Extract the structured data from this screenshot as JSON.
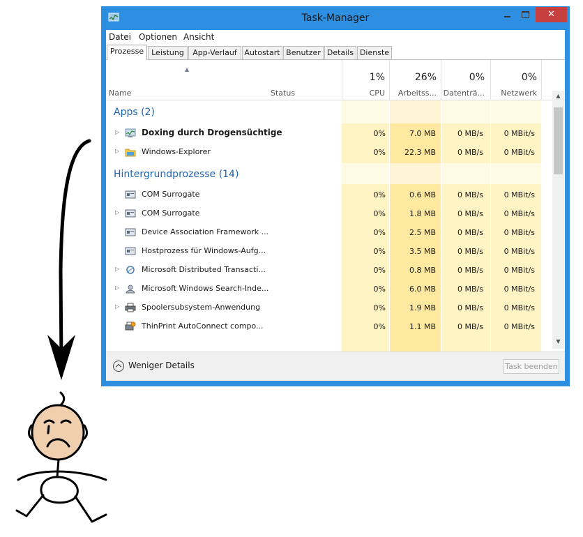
{
  "window": {
    "title": "Task-Manager"
  },
  "menu": [
    "Datei",
    "Optionen",
    "Ansicht"
  ],
  "tabs": [
    "Prozesse",
    "Leistung",
    "App-Verlauf",
    "Autostart",
    "Benutzer",
    "Details",
    "Dienste"
  ],
  "columns": {
    "name": "Name",
    "status": "Status",
    "cpu": {
      "pct": "1%",
      "label": "CPU"
    },
    "mem": {
      "pct": "26%",
      "label": "Arbeitss..."
    },
    "disk": {
      "pct": "0%",
      "label": "Datenträ..."
    },
    "net": {
      "pct": "0%",
      "label": "Netzwerk"
    }
  },
  "groups": {
    "apps": "Apps (2)",
    "background": "Hintergrundprozesse (14)"
  },
  "apps": [
    {
      "name": "Doxing durch Drogensüchtige",
      "cpu": "0%",
      "mem": "7.0 MB",
      "disk": "0 MB/s",
      "net": "0 MBit/s",
      "icon": "resource-monitor-icon"
    },
    {
      "name": "Windows-Explorer",
      "cpu": "0%",
      "mem": "22.3 MB",
      "disk": "0 MB/s",
      "net": "0 MBit/s",
      "icon": "folder-icon"
    }
  ],
  "background": [
    {
      "name": "COM Surrogate",
      "cpu": "0%",
      "mem": "0.6 MB",
      "disk": "0 MB/s",
      "net": "0 MBit/s",
      "icon": "window-app-icon"
    },
    {
      "name": "COM Surrogate",
      "cpu": "0%",
      "mem": "1.8 MB",
      "disk": "0 MB/s",
      "net": "0 MBit/s",
      "icon": "window-app-icon"
    },
    {
      "name": "Device Association Framework ...",
      "cpu": "0%",
      "mem": "2.5 MB",
      "disk": "0 MB/s",
      "net": "0 MBit/s",
      "icon": "window-app-icon"
    },
    {
      "name": "Hostprozess für Windows-Aufg...",
      "cpu": "0%",
      "mem": "3.5 MB",
      "disk": "0 MB/s",
      "net": "0 MBit/s",
      "icon": "window-app-icon"
    },
    {
      "name": "Microsoft Distributed Transacti...",
      "cpu": "0%",
      "mem": "0.8 MB",
      "disk": "0 MB/s",
      "net": "0 MBit/s",
      "icon": "transaction-icon"
    },
    {
      "name": "Microsoft Windows Search-Inde...",
      "cpu": "0%",
      "mem": "6.0 MB",
      "disk": "0 MB/s",
      "net": "0 MBit/s",
      "icon": "search-indexer-icon"
    },
    {
      "name": "Spoolersubsystem-Anwendung",
      "cpu": "0%",
      "mem": "1.9 MB",
      "disk": "0 MB/s",
      "net": "0 MBit/s",
      "icon": "printer-icon"
    },
    {
      "name": "ThinPrint AutoConnect compo...",
      "cpu": "0%",
      "mem": "1.1 MB",
      "disk": "0 MB/s",
      "net": "0 MBit/s",
      "icon": "thinprint-icon"
    }
  ],
  "footer": {
    "less": "Weniger Details",
    "end_task": "Task beenden"
  },
  "colors": {
    "accent": "#2e8ee0",
    "group_text": "#1e64b4",
    "heat_light": "#fff4c4",
    "heat_mid": "#ffe9a0",
    "close": "#c74040"
  }
}
